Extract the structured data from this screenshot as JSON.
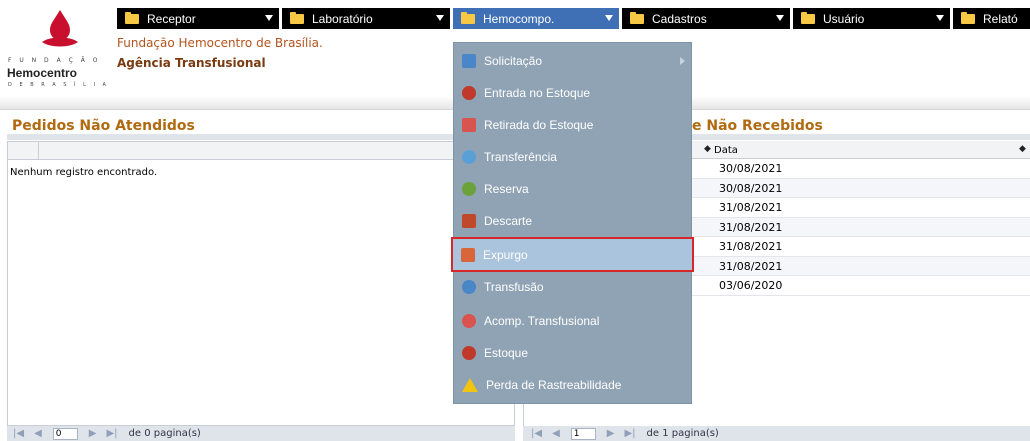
{
  "logo": {
    "line1": "F U N D A Ç Ã O",
    "name": "Hemocentro",
    "line3": "D E   B R A S Í L I A"
  },
  "menu": {
    "items": [
      {
        "label": "Receptor"
      },
      {
        "label": "Laboratório"
      },
      {
        "label": "Hemocompo."
      },
      {
        "label": "Cadastros"
      },
      {
        "label": "Usuário"
      },
      {
        "label": "Relató"
      }
    ]
  },
  "header": {
    "org": "Fundação Hemocentro de Brasília.",
    "unit": "Agência Transfusional"
  },
  "left_panel": {
    "title": "Pedidos Não Atendidos",
    "empty": "Nenhum registro encontrado.",
    "pager": {
      "page": "0",
      "total": "de 0 pagina(s)"
    }
  },
  "right_panel": {
    "title": "e Não Recebidos",
    "date_header": "Data",
    "dates": [
      "30/08/2021",
      "30/08/2021",
      "31/08/2021",
      "31/08/2021",
      "31/08/2021",
      "31/08/2021",
      "03/06/2020"
    ],
    "pager": {
      "page": "1",
      "total": "de 1 pagina(s)"
    }
  },
  "dropdown": {
    "items": [
      {
        "label": "Solicitação",
        "icon": "request-icon",
        "color": "#4a87c9"
      },
      {
        "label": "Entrada no Estoque",
        "icon": "stock-in-icon",
        "color": "#c0392b"
      },
      {
        "label": "Retirada do Estoque",
        "icon": "stock-out-icon",
        "color": "#d9534f"
      },
      {
        "label": "Transferência",
        "icon": "transfer-icon",
        "color": "#5aa0d6"
      },
      {
        "label": "Reserva",
        "icon": "reserve-icon",
        "color": "#6ba23a"
      },
      {
        "label": "Descarte",
        "icon": "discard-icon",
        "color": "#c0492b"
      },
      {
        "label": "Expurgo",
        "icon": "purge-icon",
        "color": "#d9653a"
      },
      {
        "label": "Transfusão",
        "icon": "transfusion-icon",
        "color": "#4a87c9"
      },
      {
        "label": "Acomp. Transfusional",
        "icon": "followup-icon",
        "color": "#d9534f"
      },
      {
        "label": "Estoque",
        "icon": "stock-icon",
        "color": "#c0392b"
      },
      {
        "label": "Perda de Rastreabilidade",
        "icon": "warning-icon",
        "color": "#f1c40f"
      }
    ]
  }
}
